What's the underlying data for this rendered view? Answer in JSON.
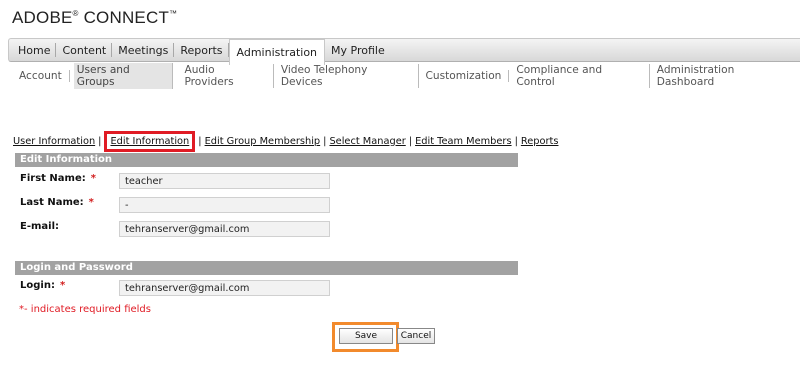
{
  "brand": {
    "name": "ADOBE",
    "reg": "®",
    "product": "CONNECT",
    "tm": "™"
  },
  "main_nav": [
    "Home",
    "Content",
    "Meetings",
    "Reports",
    "Administration",
    "My Profile"
  ],
  "sub_nav": [
    "Account",
    "Users and Groups",
    "Audio Providers",
    "Video Telephony Devices",
    "Customization",
    "Compliance and Control",
    "Administration Dashboard"
  ],
  "tab_links": [
    "User Information",
    "Edit Information",
    "Edit Group Membership",
    "Select Manager",
    "Edit Team Members",
    "Reports"
  ],
  "edit_info": {
    "header": "Edit Information",
    "first_name_label": "First Name:",
    "first_name_value": "teacher",
    "last_name_label": "Last Name:",
    "last_name_value": "-",
    "email_label": "E-mail:",
    "email_value": "tehranserver@gmail.com"
  },
  "login_password": {
    "header": "Login and Password",
    "login_label": "Login:",
    "login_value": "tehranserver@gmail.com"
  },
  "required_star": "*",
  "required_note": "*- indicates required fields",
  "buttons": {
    "save": "Save",
    "cancel": "Cancel"
  },
  "highlight_colors": {
    "edit_information_tab": "#e01b24",
    "save_button": "#f28a2c"
  }
}
